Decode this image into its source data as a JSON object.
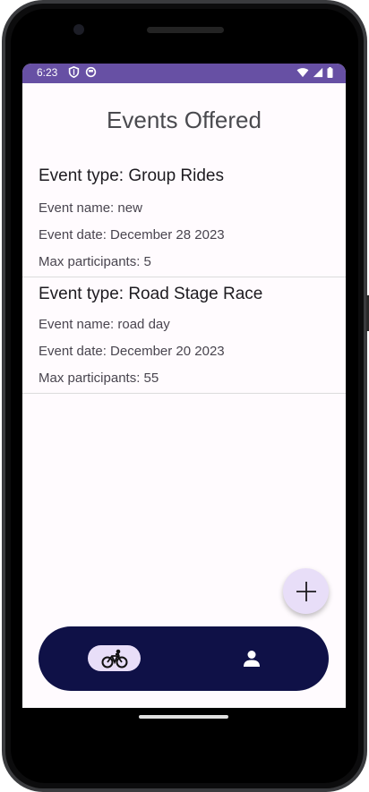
{
  "status_bar": {
    "time": "6:23"
  },
  "header": {
    "title": "Events Offered"
  },
  "events": [
    {
      "type": "Event type: Group Rides",
      "name": "Event name: new",
      "date": "Event date: December 28 2023",
      "max": "Max participants: 5"
    },
    {
      "type": "Event type: Road Stage Race",
      "name": "Event name: road day",
      "date": "Event date: December 20 2023",
      "max": "Max participants: 55"
    }
  ],
  "bottom_nav": {
    "items": [
      {
        "icon": "bike-icon",
        "selected": true
      },
      {
        "icon": "person-icon",
        "selected": false
      }
    ]
  },
  "fab": {
    "icon": "plus-icon"
  },
  "colors": {
    "status_bar": "#6750a4",
    "nav_bar": "#0f1147",
    "accent_container": "#e8def8"
  }
}
